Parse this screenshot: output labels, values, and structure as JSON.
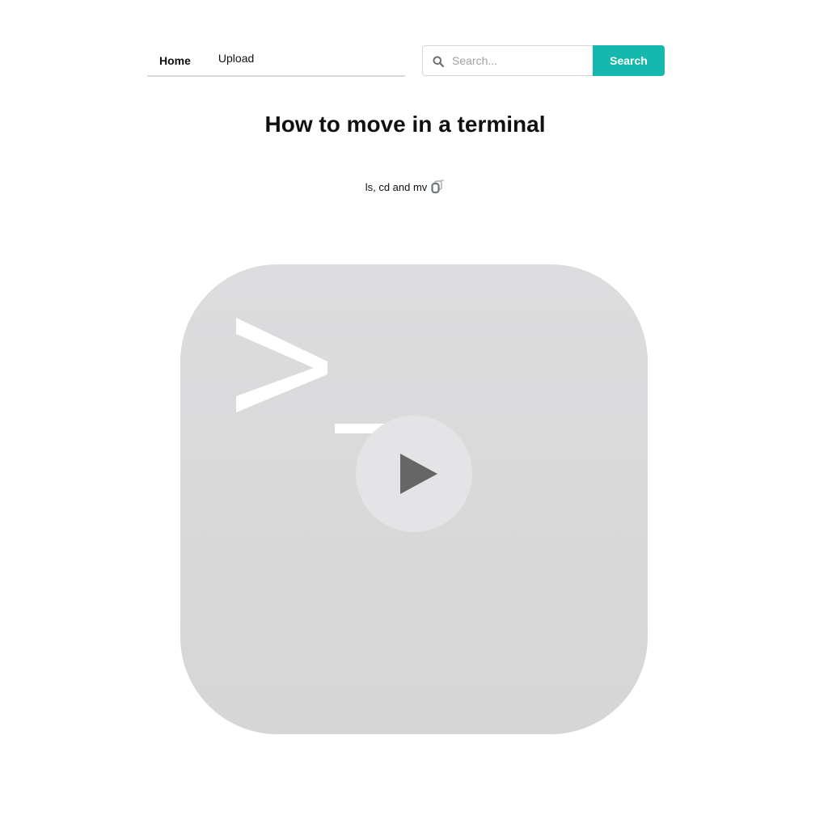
{
  "nav": {
    "items": [
      {
        "label": "Home",
        "active": true
      },
      {
        "label": "Upload",
        "active": false
      }
    ]
  },
  "search": {
    "placeholder": "Search...",
    "value": "",
    "button_label": "Search",
    "icon": "search-icon"
  },
  "video": {
    "title": "How to move in a terminal",
    "description": "ls, cd and mv",
    "description_icon": "copy-icon",
    "thumbnail_icon": "terminal-prompt-icon",
    "overlay_icon": "play-icon"
  },
  "colors": {
    "accent": "#14b8ad",
    "thumbnail_bg": "#d9d9d9",
    "play_button_bg": "#e4e4e6",
    "play_icon": "#666666",
    "nav_underline": "#d9d9d9"
  }
}
